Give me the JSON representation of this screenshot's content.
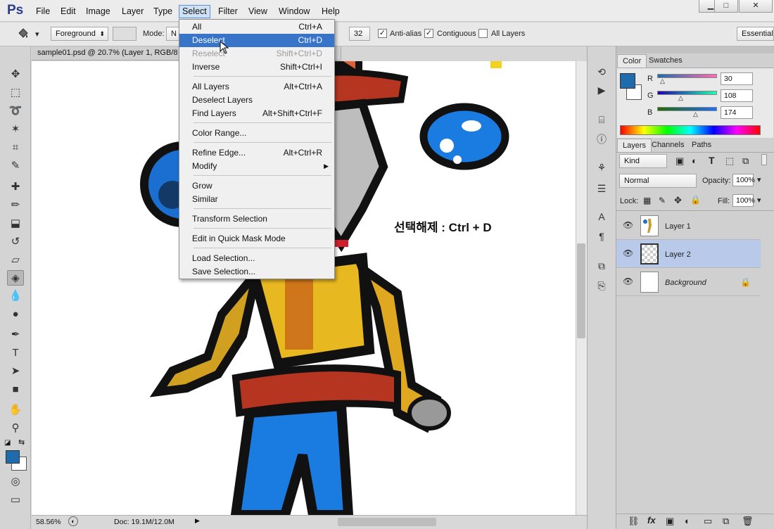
{
  "app": {
    "logo": "Ps"
  },
  "menubar": {
    "items": [
      "File",
      "Edit",
      "Image",
      "Layer",
      "Type",
      "Select",
      "Filter",
      "View",
      "Window",
      "Help"
    ],
    "active": "Select"
  },
  "window_controls": {
    "minimize": "▁",
    "maximize": "□",
    "close": "✕"
  },
  "options_bar": {
    "fill_source": "Foreground",
    "mode_label": "Mode:",
    "mode_value": "N",
    "tolerance_value": "32",
    "anti_alias": {
      "label": "Anti-alias",
      "checked": true
    },
    "contiguous": {
      "label": "Contiguous",
      "checked": true
    },
    "all_layers": {
      "label": "All Layers",
      "checked": false
    },
    "workspace": "Essentials"
  },
  "document": {
    "tab_title": "sample01.psd @ 20.7% (Layer 1, RGB/8",
    "annotation": "선택해제 : Ctrl + D"
  },
  "status_bar": {
    "zoom": "58.56%",
    "doc_info": "Doc: 19.1M/12.0M"
  },
  "select_menu": {
    "items": [
      {
        "label": "All",
        "shortcut": "Ctrl+A",
        "state": "normal"
      },
      {
        "label": "Deselect",
        "shortcut": "Ctrl+D",
        "state": "highlighted"
      },
      {
        "label": "Reselect",
        "shortcut": "Shift+Ctrl+D",
        "state": "disabled"
      },
      {
        "label": "Inverse",
        "shortcut": "Shift+Ctrl+I",
        "state": "normal"
      },
      {
        "label": "All Layers",
        "shortcut": "Alt+Ctrl+A",
        "state": "normal"
      },
      {
        "label": "Deselect Layers",
        "shortcut": "",
        "state": "normal"
      },
      {
        "label": "Find Layers",
        "shortcut": "Alt+Shift+Ctrl+F",
        "state": "normal"
      },
      {
        "label": "Color Range...",
        "shortcut": "",
        "state": "normal"
      },
      {
        "label": "Refine Edge...",
        "shortcut": "Alt+Ctrl+R",
        "state": "normal"
      },
      {
        "label": "Modify",
        "shortcut": "",
        "state": "submenu"
      },
      {
        "label": "Grow",
        "shortcut": "",
        "state": "normal"
      },
      {
        "label": "Similar",
        "shortcut": "",
        "state": "normal"
      },
      {
        "label": "Transform Selection",
        "shortcut": "",
        "state": "normal"
      },
      {
        "label": "Edit in Quick Mask Mode",
        "shortcut": "",
        "state": "normal"
      },
      {
        "label": "Load Selection...",
        "shortcut": "",
        "state": "normal"
      },
      {
        "label": "Save Selection...",
        "shortcut": "",
        "state": "normal"
      }
    ]
  },
  "color_panel": {
    "tabs": [
      "Color",
      "Swatches"
    ],
    "active_tab": "Color",
    "r": {
      "label": "R",
      "value": "30"
    },
    "g": {
      "label": "G",
      "value": "108"
    },
    "b": {
      "label": "B",
      "value": "174"
    },
    "foreground_color": "#1e6cae"
  },
  "layers_panel": {
    "tabs": [
      "Layers",
      "Channels",
      "Paths"
    ],
    "active_tab": "Layers",
    "filter": "Kind",
    "blend_mode": "Normal",
    "opacity_label": "Opacity:",
    "opacity": "100%",
    "lock_label": "Lock:",
    "fill_label": "Fill:",
    "fill": "100%",
    "layers": [
      {
        "name": "Layer 1",
        "selected": false,
        "locked": false
      },
      {
        "name": "Layer 2",
        "selected": true,
        "locked": false
      },
      {
        "name": "Background",
        "selected": false,
        "locked": true
      }
    ]
  }
}
